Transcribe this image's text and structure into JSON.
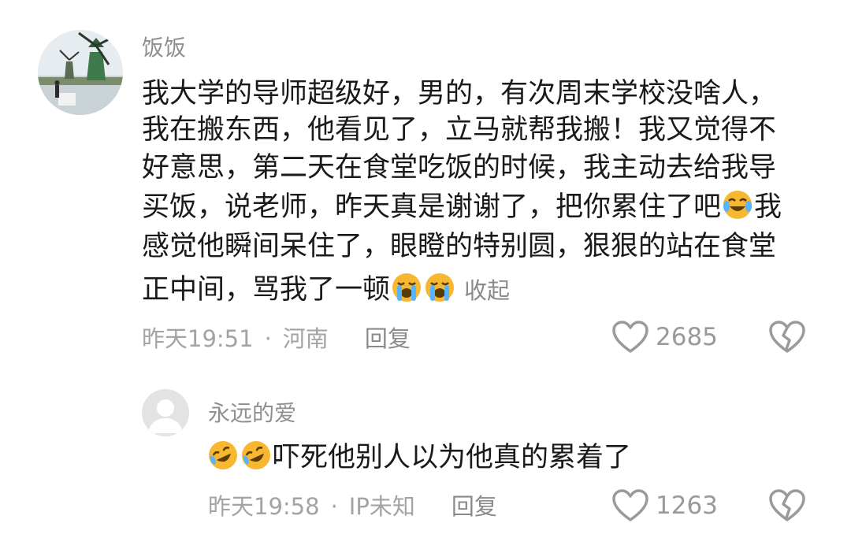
{
  "comment": {
    "username": "饭饭",
    "lines": [
      "我大学的导师超级好，男的，有次周末学校没啥人，",
      "我在搬东西，他看见了，立马就帮我搬！我又觉得不",
      "好意思，第二天在食堂吃饭的时候，我主动去给我导",
      "买饭，说老师，昨天真是谢谢了，把你累住了吧",
      "感觉他瞬间呆住了，眼瞪的特别圆，狠狠的站在食堂",
      "正中间，骂我了一顿"
    ],
    "line4_tail": "我",
    "collapse_label": "收起",
    "time": "昨天19:51",
    "location": "河南",
    "dot": "·",
    "reply_label": "回复",
    "like_count": "2685"
  },
  "reply": {
    "username": "永远的爱",
    "text": "吓死他别人以为他真的累着了",
    "time": "昨天19:58",
    "location": "IP未知",
    "dot": "·",
    "reply_label": "回复",
    "like_count": "1263"
  },
  "icons": {
    "heart": "heart-outline-icon",
    "broken_heart": "broken-heart-icon",
    "emoji_cry_laugh": "tears-of-joy-emoji",
    "emoji_crying": "loudly-crying-emoji",
    "emoji_rofl": "rolling-laughing-emoji"
  },
  "colors": {
    "text_primary": "#1a1a1a",
    "text_secondary": "#8f8f8f",
    "emoji_yellow": "#f7b731"
  }
}
